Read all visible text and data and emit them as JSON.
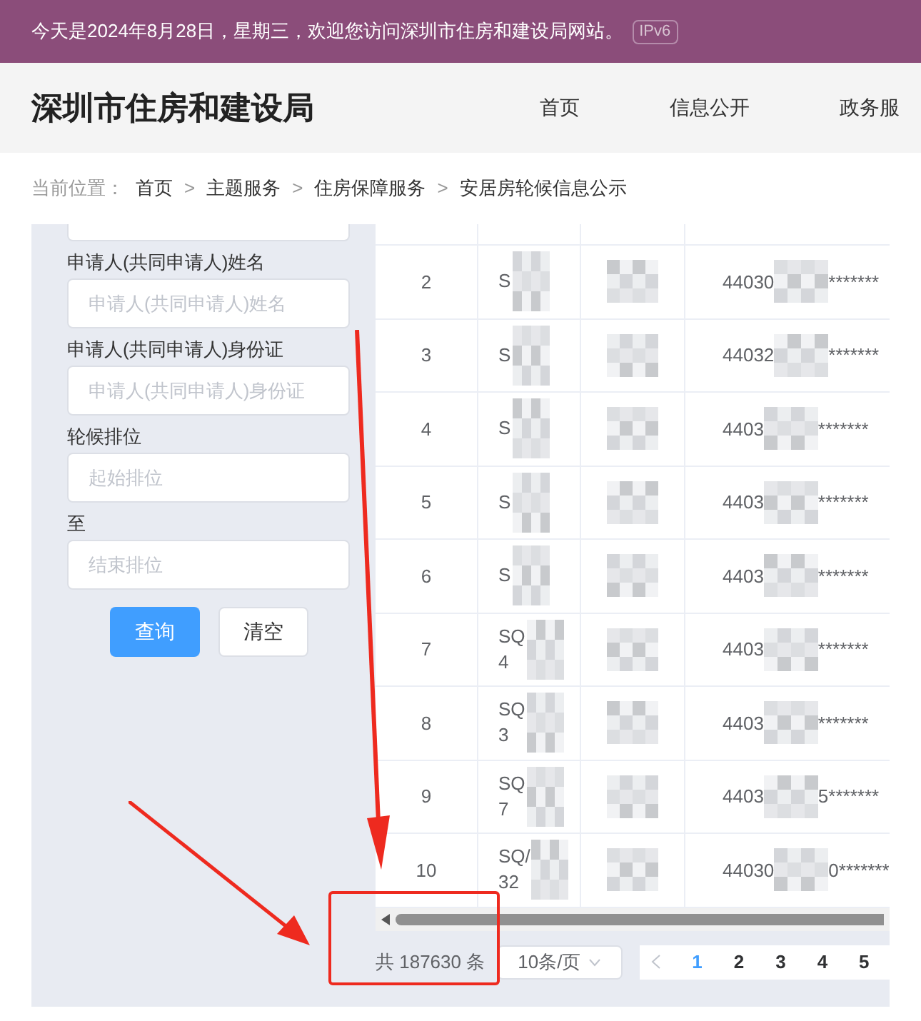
{
  "top_bar": {
    "greeting": "今天是2024年8月28日，星期三，欢迎您访问深圳市住房和建设局网站。",
    "badge": "IPv6"
  },
  "header": {
    "site_title": "深圳市住房和建设局",
    "nav": [
      {
        "label": "首页",
        "selected": false
      },
      {
        "label": "信息公开",
        "selected": false
      },
      {
        "label": "政务服",
        "selected": false
      }
    ]
  },
  "breadcrumb": {
    "label": "当前位置：",
    "items": [
      "首页",
      "主题服务",
      "住房保障服务",
      "安居房轮候信息公示"
    ],
    "separator": ">"
  },
  "filter_form": {
    "fields": [
      {
        "label": "申请人(共同申请人)姓名",
        "placeholder": "申请人(共同申请人)姓名"
      },
      {
        "label": "申请人(共同申请人)身份证",
        "placeholder": "申请人(共同申请人)身份证"
      },
      {
        "label": "轮候排位",
        "placeholder": "起始排位"
      },
      {
        "label": "至",
        "placeholder": "结束排位"
      }
    ],
    "buttons": [
      {
        "label": "查询",
        "kind": "primary"
      },
      {
        "label": "清空",
        "kind": "plain"
      }
    ]
  },
  "table": {
    "rows": [
      {
        "rank": "2",
        "code": "S",
        "code_line2": "",
        "id_prefix": "44030",
        "id_suffix": "*******"
      },
      {
        "rank": "3",
        "code": "S",
        "code_line2": "",
        "id_prefix": "44032",
        "id_suffix": "*******"
      },
      {
        "rank": "4",
        "code": "S",
        "code_line2": "",
        "id_prefix": "4403",
        "id_suffix": "*******"
      },
      {
        "rank": "5",
        "code": "S",
        "code_line2": "",
        "id_prefix": "4403",
        "id_suffix": "*******"
      },
      {
        "rank": "6",
        "code": "S",
        "code_line2": "",
        "id_prefix": "4403",
        "id_suffix": "*******"
      },
      {
        "rank": "7",
        "code": "SQ",
        "code_line2": "4",
        "id_prefix": "4403",
        "id_suffix": "*******"
      },
      {
        "rank": "8",
        "code": "SQ",
        "code_line2": "3",
        "id_prefix": "4403",
        "id_suffix": "*******"
      },
      {
        "rank": "9",
        "code": "SQ",
        "code_line2": "7",
        "id_prefix": "4403",
        "id_suffix": "5*******"
      },
      {
        "rank": "10",
        "code": "SQ/",
        "code_line2": "32",
        "id_prefix": "44030",
        "id_suffix": "0*******"
      }
    ]
  },
  "pagination": {
    "total": "共 187630 条",
    "page_size": "10条/页",
    "pages": [
      {
        "label": "1",
        "selected": true
      },
      {
        "label": "2",
        "selected": false
      },
      {
        "label": "3",
        "selected": false
      },
      {
        "label": "4",
        "selected": false
      },
      {
        "label": "5",
        "selected": false
      }
    ]
  }
}
